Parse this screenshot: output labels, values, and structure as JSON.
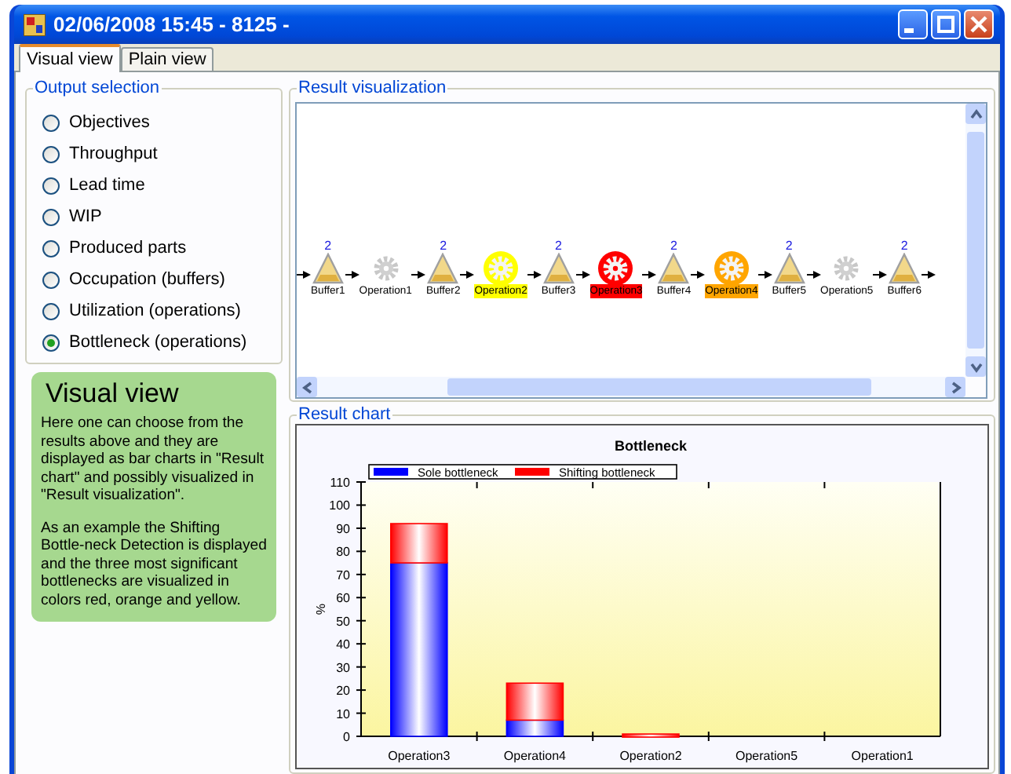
{
  "window": {
    "title": "02/06/2008 15:45 - 8125 -"
  },
  "tabs": [
    {
      "label": "Visual view",
      "selected": true
    },
    {
      "label": "Plain view",
      "selected": false
    }
  ],
  "output_selection": {
    "title": "Output selection",
    "options": [
      {
        "label": "Objectives",
        "selected": false
      },
      {
        "label": "Throughput",
        "selected": false
      },
      {
        "label": "Lead time",
        "selected": false
      },
      {
        "label": "WIP",
        "selected": false
      },
      {
        "label": "Produced parts",
        "selected": false
      },
      {
        "label": "Occupation (buffers)",
        "selected": false
      },
      {
        "label": "Utilization (operations)",
        "selected": false
      },
      {
        "label": "Bottleneck (operations)",
        "selected": true
      }
    ]
  },
  "note": {
    "title": "Visual view",
    "paragraphs": [
      "Here one can choose from the results above and they are displayed as bar charts in \"Result chart\" and possibly visualized in \"Result visualization\".",
      "As an example the Shifting Bottle-neck Detection is displayed and the three most significant bottlenecks are visualized in colors red, orange and yellow."
    ]
  },
  "result_visualization": {
    "title": "Result visualization",
    "nodes": [
      {
        "kind": "buffer",
        "label": "Buffer1",
        "count": "2"
      },
      {
        "kind": "operation",
        "label": "Operation1"
      },
      {
        "kind": "buffer",
        "label": "Buffer2",
        "count": "2"
      },
      {
        "kind": "operation",
        "label": "Operation2",
        "color": "#ffff00"
      },
      {
        "kind": "buffer",
        "label": "Buffer3",
        "count": "2"
      },
      {
        "kind": "operation",
        "label": "Operation3",
        "color": "#ff0000"
      },
      {
        "kind": "buffer",
        "label": "Buffer4",
        "count": "2"
      },
      {
        "kind": "operation",
        "label": "Operation4",
        "color": "#ffa500"
      },
      {
        "kind": "buffer",
        "label": "Buffer5",
        "count": "2"
      },
      {
        "kind": "operation",
        "label": "Operation5"
      },
      {
        "kind": "buffer",
        "label": "Buffer6",
        "count": "2"
      }
    ]
  },
  "result_chart": {
    "title": "Result chart",
    "chart_data": {
      "type": "bar",
      "title": "Bottleneck",
      "ylabel": "%",
      "categories": [
        "Operation3",
        "Operation4",
        "Operation2",
        "Operation5",
        "Operation1"
      ],
      "series": [
        {
          "name": "Sole bottleneck",
          "color": "#0000ff",
          "values": [
            75,
            7,
            0,
            0,
            0
          ]
        },
        {
          "name": "Shifting bottleneck",
          "color": "#ff0000",
          "values": [
            17,
            16,
            1,
            0,
            0
          ]
        }
      ],
      "stacked": true,
      "legend": "top",
      "ylim": [
        0,
        110
      ],
      "yticks": [
        0,
        10,
        20,
        30,
        40,
        50,
        60,
        70,
        80,
        90,
        100,
        110
      ]
    }
  }
}
